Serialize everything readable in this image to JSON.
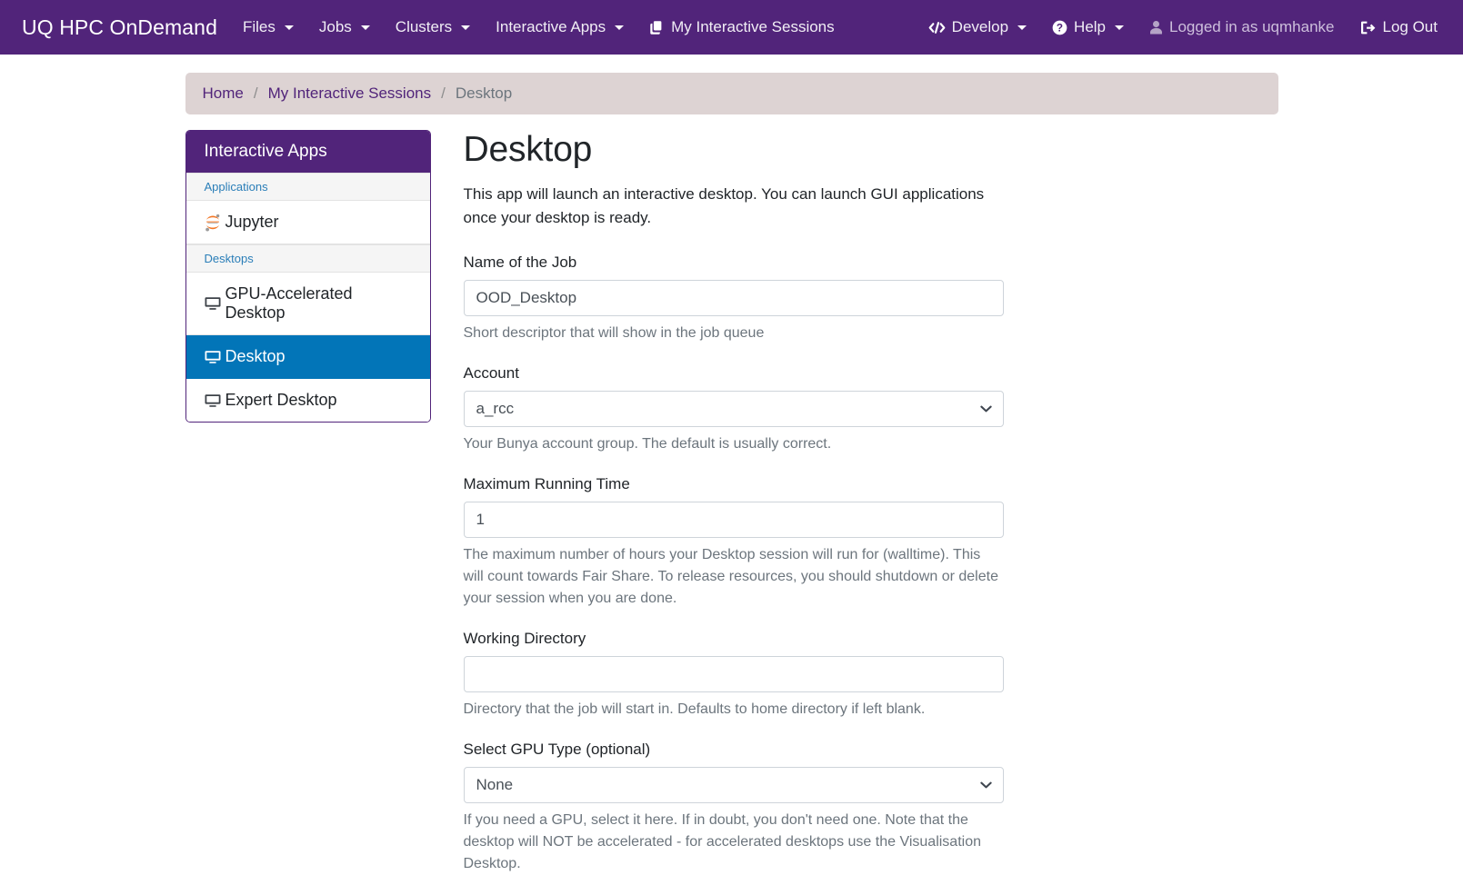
{
  "navbar": {
    "brand": "UQ HPC OnDemand",
    "left_items": [
      {
        "label": "Files",
        "caret": true,
        "icon": null
      },
      {
        "label": "Jobs",
        "caret": true,
        "icon": null
      },
      {
        "label": "Clusters",
        "caret": true,
        "icon": null
      },
      {
        "label": "Interactive Apps",
        "caret": true,
        "icon": null
      },
      {
        "label": "My Interactive Sessions",
        "caret": false,
        "icon": "layers-icon"
      }
    ],
    "right_items": [
      {
        "label": "Develop",
        "caret": true,
        "icon": "code-icon"
      },
      {
        "label": "Help",
        "caret": true,
        "icon": "question-circle-icon"
      },
      {
        "label": "Logged in as uqmhanke",
        "caret": false,
        "icon": "user-icon"
      },
      {
        "label": "Log Out",
        "caret": false,
        "icon": "logout-icon"
      }
    ]
  },
  "breadcrumb": {
    "home": "Home",
    "sep": "/",
    "sessions": "My Interactive Sessions",
    "current": "Desktop"
  },
  "sidebar": {
    "header": "Interactive Apps",
    "groups": [
      {
        "heading": "Applications",
        "items": [
          {
            "label": "Jupyter",
            "icon": "jupyter-icon",
            "active": false
          }
        ]
      },
      {
        "heading": "Desktops",
        "items": [
          {
            "label": "GPU-Accelerated Desktop",
            "icon": "desktop-icon",
            "active": false
          },
          {
            "label": "Desktop",
            "icon": "desktop-icon",
            "active": true
          },
          {
            "label": "Expert Desktop",
            "icon": "desktop-icon",
            "active": false
          }
        ]
      }
    ]
  },
  "main": {
    "title": "Desktop",
    "lead": "This app will launch an interactive desktop. You can launch GUI applications once your desktop is ready.",
    "fields": {
      "job_name": {
        "label": "Name of the Job",
        "value": "OOD_Desktop",
        "placeholder": "",
        "help": "Short descriptor that will show in the job queue"
      },
      "account": {
        "label": "Account",
        "value": "a_rcc",
        "options": [
          "a_rcc"
        ],
        "help": "Your Bunya account group. The default is usually correct."
      },
      "max_time": {
        "label": "Maximum Running Time",
        "value": "1",
        "placeholder": "",
        "help": "The maximum number of hours your Desktop session will run for (walltime). This will count towards Fair Share. To release resources, you should shutdown or delete your session when you are done."
      },
      "working_dir": {
        "label": "Working Directory",
        "value": "",
        "placeholder": "",
        "help": "Directory that the job will start in. Defaults to home directory if left blank."
      },
      "gpu_type": {
        "label": "Select GPU Type (optional)",
        "value": "None",
        "options": [
          "None"
        ],
        "help": "If you need a GPU, select it here. If in doubt, you don't need one. Note that the desktop will NOT be accelerated - for accelerated desktops use the Visualisation Desktop."
      }
    }
  },
  "colors": {
    "brand_purple": "#51247a",
    "active_blue": "#0275b8",
    "breadcrumb_bg": "#ddd3d3",
    "link_blue": "#2a7eb8",
    "muted": "#6c757d"
  }
}
